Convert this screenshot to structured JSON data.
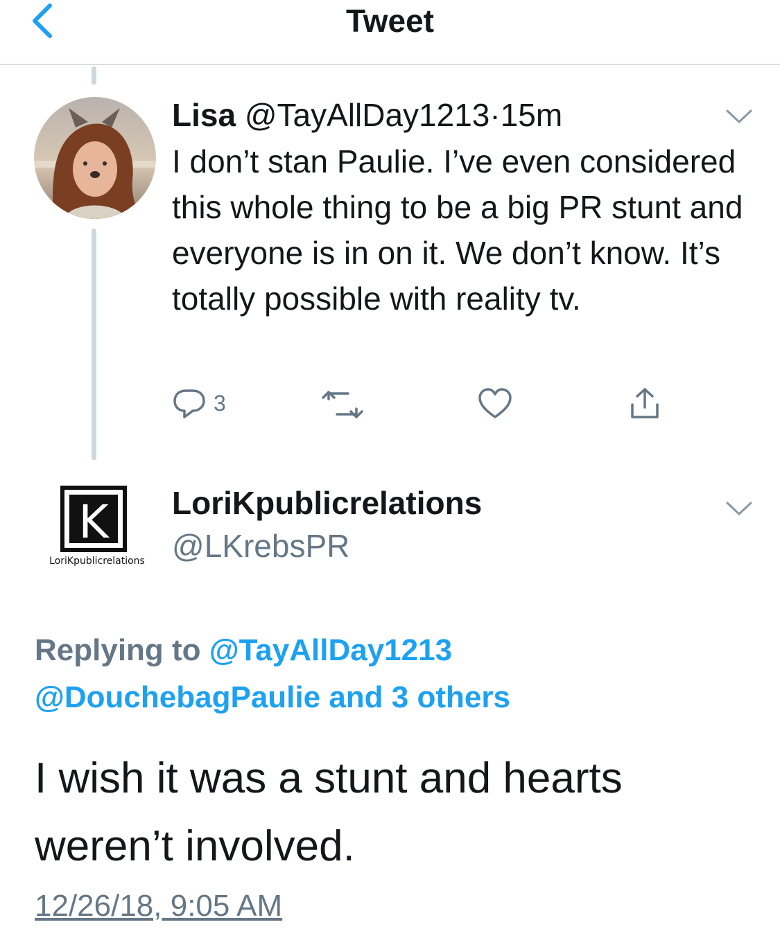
{
  "nav": {
    "title": "Tweet"
  },
  "parent_tweet": {
    "name": "Lisa",
    "handle": "@TayAllDay1213",
    "dot": "·",
    "time": "15m",
    "text": "I don’t stan Paulie. I’ve even considered this whole thing to be a big PR stunt and everyone is in on it. We don’t know. It’s totally possible with reality tv.",
    "reply_count": "3"
  },
  "main_tweet": {
    "name": "LoriKpublicrelations",
    "handle": "@LKrebsPR",
    "logo_letter": "K",
    "logo_caption": "LoriKpublicrelations",
    "replying_label": "Replying to ",
    "replying_to": "@TayAllDay1213",
    "replying_more": "@DouchebagPaulie and 3 others",
    "text": "I wish it was a stunt and hearts weren’t involved.",
    "timestamp": "12/26/18, 9:05 AM"
  },
  "colors": {
    "accent": "#1da1f2",
    "secondary_text": "#657786",
    "divider": "#d9dde1"
  }
}
